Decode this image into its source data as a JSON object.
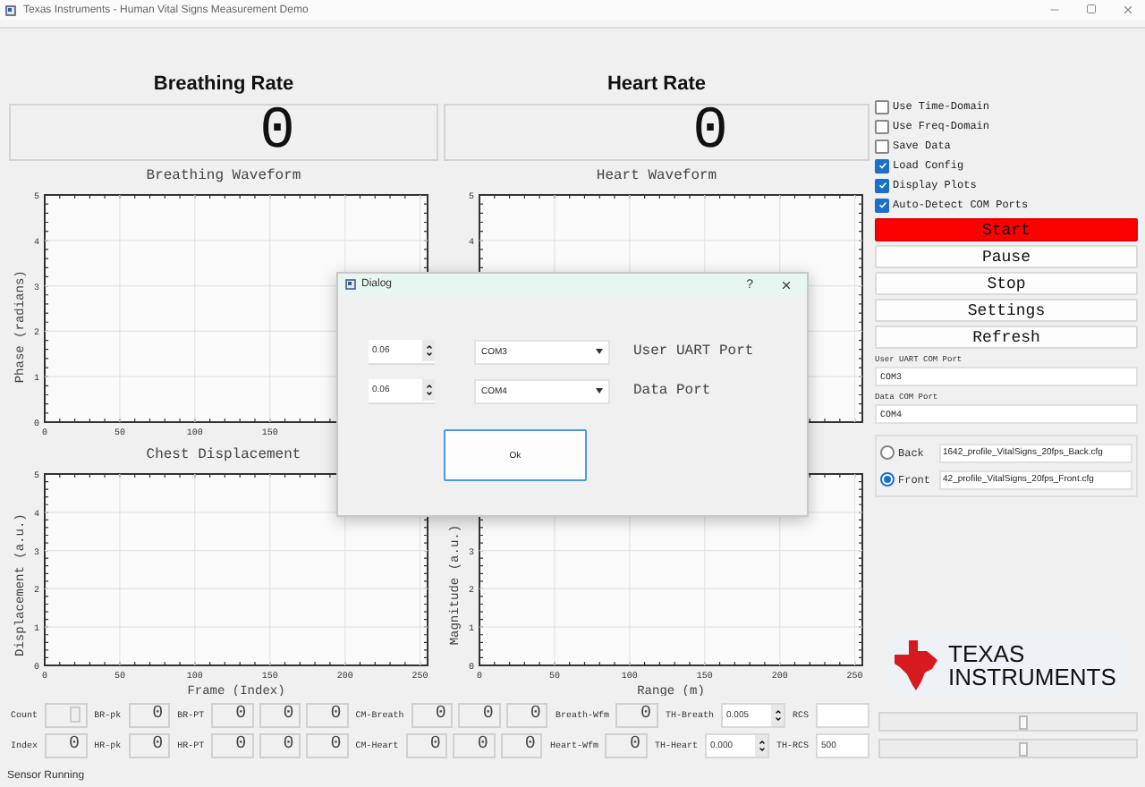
{
  "window": {
    "title": "Texas Instruments - Human Vital Signs Measurement Demo"
  },
  "rates": [
    {
      "title": "Breathing Rate",
      "value": "0"
    },
    {
      "title": "Heart Rate",
      "value": "0"
    }
  ],
  "plots": [
    {
      "chart_data": {
        "type": "line",
        "grid": true,
        "title": "Breathing Waveform",
        "ylabel": "Phase (radians)",
        "xlim": [
          0,
          255
        ],
        "ylim": [
          0,
          5
        ],
        "xticks": [
          0,
          50,
          100,
          150
        ],
        "yticks": [
          0,
          1,
          2,
          3,
          4,
          5
        ]
      }
    },
    {
      "chart_data": {
        "type": "line",
        "grid": true,
        "title": "Heart Waveform",
        "xlim": [
          0,
          255
        ],
        "ylim": [
          0,
          5
        ],
        "yticks": [
          4,
          5
        ]
      }
    },
    {
      "chart_data": {
        "type": "line",
        "grid": true,
        "title": "Chest Displacement",
        "xlabel": "Frame (Index)",
        "ylabel": "Displacement (a.u.)",
        "xlim": [
          0,
          255
        ],
        "ylim": [
          0,
          5
        ],
        "xticks": [
          0,
          50,
          100,
          150,
          200,
          250
        ],
        "yticks": [
          0,
          1,
          2,
          3,
          4,
          5
        ]
      }
    },
    {
      "chart_data": {
        "type": "line",
        "grid": true,
        "xlabel": "Range (m)",
        "ylabel": "Magnitude (a.u.)",
        "xlim": [
          0,
          255
        ],
        "ylim": [
          0,
          5
        ],
        "xticks": [
          0,
          50,
          100,
          150,
          200,
          250
        ],
        "yticks": [
          0,
          1,
          2,
          3
        ]
      }
    }
  ],
  "readouts": [
    {
      "items": [
        {
          "kind": "label",
          "text": "Count"
        },
        {
          "kind": "lcd"
        },
        {
          "kind": "label",
          "text": "BR-pk"
        },
        {
          "kind": "lcd",
          "value": "0"
        },
        {
          "kind": "label",
          "text": "BR-PT"
        },
        {
          "kind": "lcd",
          "value": "0"
        },
        {
          "kind": "lcd",
          "value": "0"
        },
        {
          "kind": "lcd",
          "value": "0"
        },
        {
          "kind": "label",
          "text": "CM-Breath"
        },
        {
          "kind": "lcd",
          "value": "0"
        },
        {
          "kind": "lcd",
          "value": "0"
        },
        {
          "kind": "lcd",
          "value": "0"
        },
        {
          "kind": "label",
          "text": "Breath-Wfm"
        },
        {
          "kind": "lcd",
          "value": "0"
        },
        {
          "kind": "label",
          "text": "TH-Breath"
        },
        {
          "kind": "spin",
          "value": "0.005"
        },
        {
          "kind": "label",
          "text": "RCS"
        },
        {
          "kind": "field"
        }
      ]
    },
    {
      "items": [
        {
          "kind": "label",
          "text": "Index"
        },
        {
          "kind": "lcd",
          "value": "0"
        },
        {
          "kind": "label",
          "text": "HR-pk"
        },
        {
          "kind": "lcd",
          "value": "0"
        },
        {
          "kind": "label",
          "text": "HR-PT"
        },
        {
          "kind": "lcd",
          "value": "0"
        },
        {
          "kind": "lcd",
          "value": "0"
        },
        {
          "kind": "lcd",
          "value": "0"
        },
        {
          "kind": "label",
          "text": "CM-Heart"
        },
        {
          "kind": "lcd",
          "value": "0"
        },
        {
          "kind": "lcd",
          "value": "0"
        },
        {
          "kind": "lcd",
          "value": "0"
        },
        {
          "kind": "label",
          "text": "Heart-Wfm"
        },
        {
          "kind": "lcd",
          "value": "0"
        },
        {
          "kind": "label",
          "text": "TH-Heart"
        },
        {
          "kind": "spin",
          "value": "0.000"
        },
        {
          "kind": "label",
          "text": "TH-RCS"
        },
        {
          "kind": "field",
          "value": "500"
        }
      ]
    }
  ],
  "options": [
    {
      "label": "Use Time-Domain",
      "checked": false
    },
    {
      "label": "Use Freq-Domain",
      "checked": false
    },
    {
      "label": "Save Data",
      "checked": false
    },
    {
      "label": "Load Config",
      "checked": true
    },
    {
      "label": "Display Plots",
      "checked": true
    },
    {
      "label": "Auto-Detect COM Ports",
      "checked": true
    }
  ],
  "buttons": [
    {
      "label": "Start",
      "kind": "primary"
    },
    {
      "label": "Pause",
      "kind": "normal"
    },
    {
      "label": "Stop",
      "kind": "normal"
    },
    {
      "label": "Settings",
      "kind": "normal"
    },
    {
      "label": "Refresh",
      "kind": "normal"
    }
  ],
  "ports": [
    {
      "label": "User UART COM Port",
      "value": "COM3"
    },
    {
      "label": "Data COM Port",
      "value": "COM4"
    }
  ],
  "configs": [
    {
      "label": "Back",
      "selected": false,
      "file": "1642_profile_VitalSigns_20fps_Back.cfg"
    },
    {
      "label": "Front",
      "selected": true,
      "file": "42_profile_VitalSigns_20fps_Front.cfg"
    }
  ],
  "logo": {
    "line_1": "TEXAS",
    "line_2": "INSTRUMENTS"
  },
  "sliders": [
    {
      "level": 0.56
    },
    {
      "level": 0.56
    }
  ],
  "status_bar": "Sensor Running",
  "dialog": {
    "title": "Dialog",
    "help": "?",
    "rows": [
      {
        "spin": "0.06",
        "port": "COM3",
        "label": "User UART Port"
      },
      {
        "spin": "0.06",
        "port": "COM4",
        "label": "Data Port"
      }
    ],
    "ok": "Ok"
  }
}
